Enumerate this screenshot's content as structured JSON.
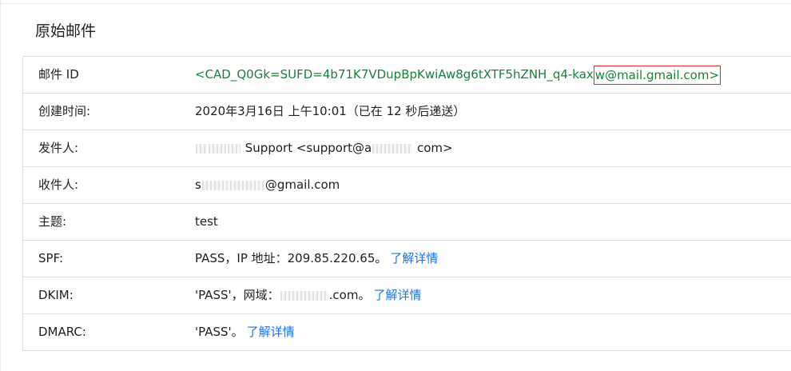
{
  "page": {
    "title": "原始邮件"
  },
  "rows": {
    "message_id": {
      "label": "邮件 ID",
      "value_prefix": "<CAD_Q0Gk=SUFD=4b71K7VDupBpKwiAw8g6tXTF5hZNH_q4-kax",
      "value_highlighted": "w@mail.gmail.com>"
    },
    "created": {
      "label": "创建时间:",
      "value": "2020年3月16日 上午10:01（已在 12 秒后递送）"
    },
    "from": {
      "label": "发件人:",
      "value_middle": "Support <support@a",
      "value_end": "com>"
    },
    "to": {
      "label": "收件人:",
      "value_start": "s",
      "value_end": "@gmail.com"
    },
    "subject": {
      "label": "主题:",
      "value": "test"
    },
    "spf": {
      "label": "SPF:",
      "value": "PASS，IP 地址：209.85.220.65。",
      "link": "了解详情"
    },
    "dkim": {
      "label": "DKIM:",
      "value_start": "'PASS'，网域：",
      "value_end": ".com。",
      "link": "了解详情"
    },
    "dmarc": {
      "label": "DMARC:",
      "value": "'PASS'。",
      "link": "了解详情"
    }
  },
  "colors": {
    "text": "#202124",
    "message_id_green": "#188038",
    "link_blue": "#1a73e8",
    "highlight_red": "#d93025",
    "border": "#e0e0e0"
  }
}
